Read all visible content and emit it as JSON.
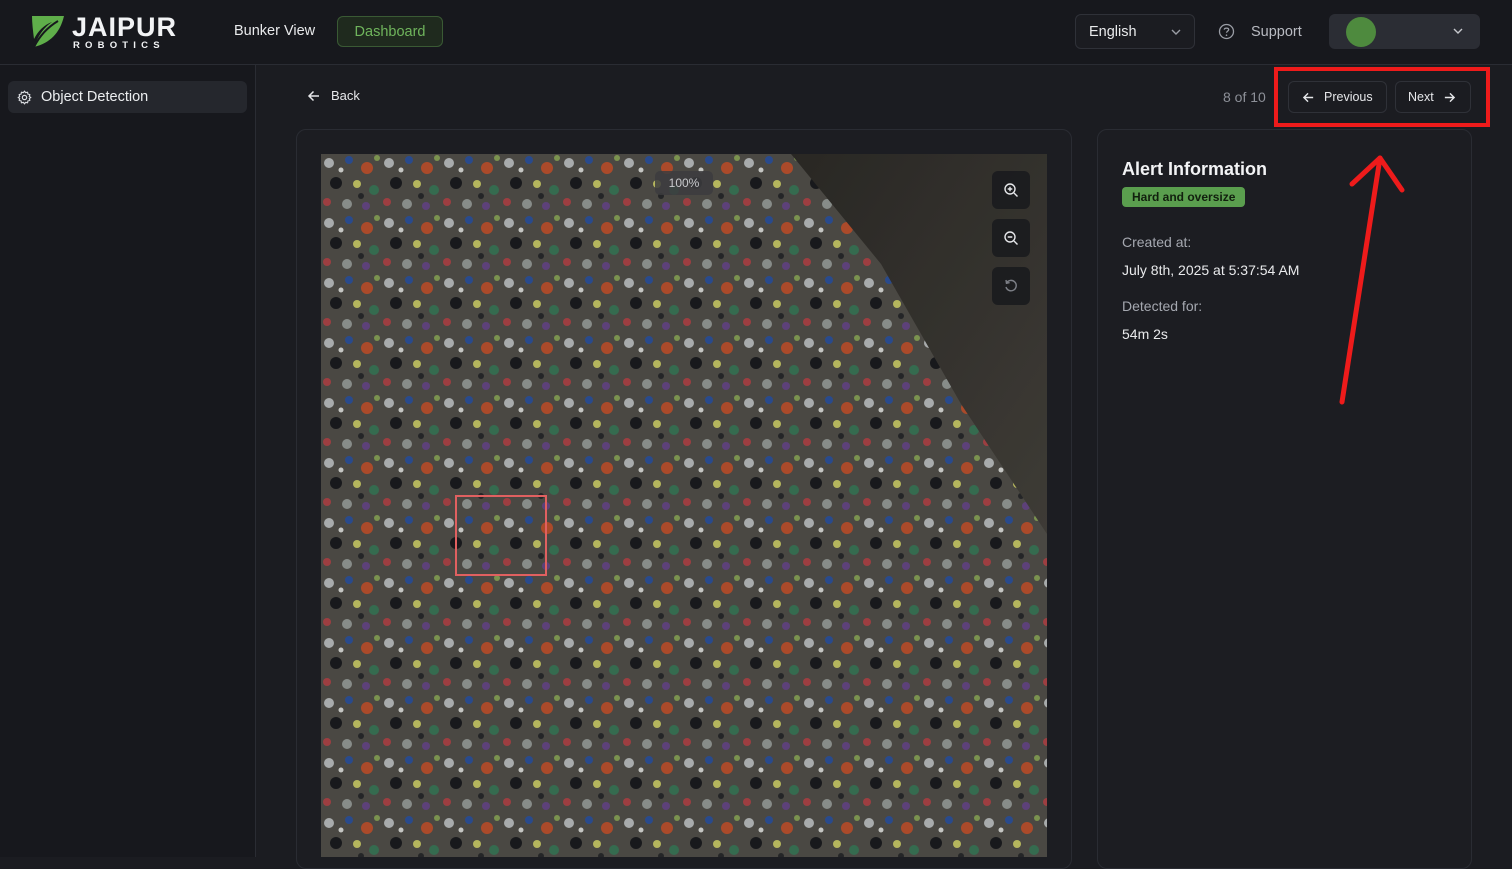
{
  "header": {
    "brand_name": "JAIPUR",
    "brand_sub": "ROBOTICS",
    "nav_bunker_view": "Bunker View",
    "nav_dashboard": "Dashboard",
    "language": "English",
    "support": "Support"
  },
  "sidebar": {
    "items": [
      {
        "label": "Object Detection",
        "icon": "gear-icon"
      }
    ]
  },
  "toolbar": {
    "back_label": "Back",
    "counter": "8 of 10",
    "previous_label": "Previous",
    "next_label": "Next"
  },
  "viewer": {
    "zoom_level": "100%",
    "tools": [
      "zoom-in-icon",
      "zoom-out-icon",
      "reset-icon"
    ]
  },
  "alert": {
    "title": "Alert Information",
    "badge": "Hard and oversize",
    "created_label": "Created at:",
    "created_value": "July 8th, 2025 at 5:37:54 AM",
    "detected_label": "Detected for:",
    "detected_value": "54m 2s"
  },
  "colors": {
    "accent_green": "#6fb45c",
    "badge_green": "#5a9e4e",
    "annotation_red": "#ee1b1b",
    "bbox_red": "#e06060"
  }
}
